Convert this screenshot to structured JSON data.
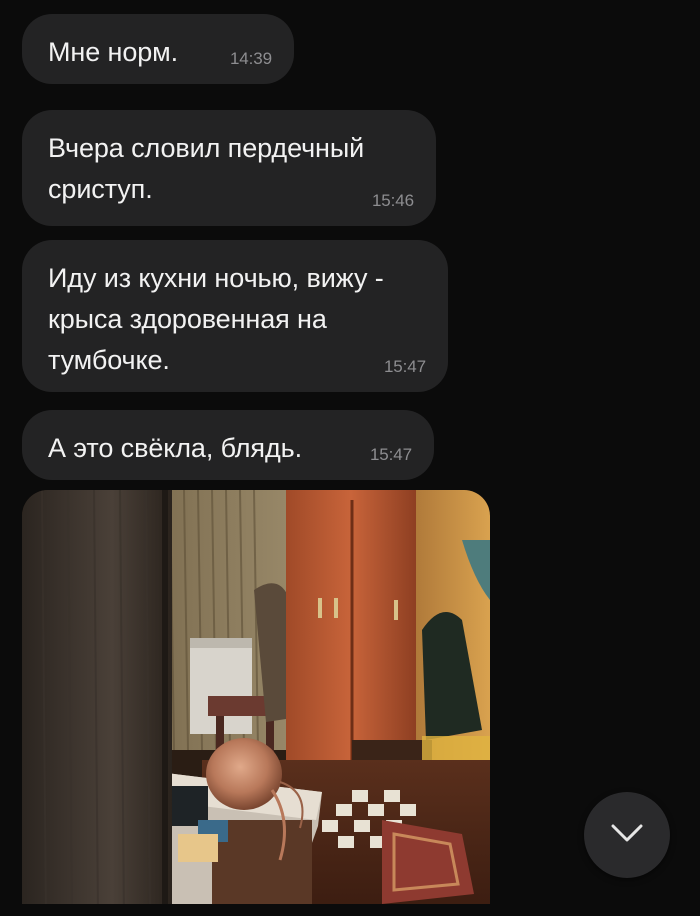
{
  "messages": [
    {
      "text": "Мне норм.",
      "time": "14:39"
    },
    {
      "text": "Вчера словил пердечный сриступ.",
      "time": "15:46"
    },
    {
      "text": "Иду из кухни ночью, вижу - крыса здоровенная на тумбочке.",
      "time": "15:47"
    },
    {
      "text": "А это свёкла, блядь.",
      "time": "15:47"
    }
  ],
  "scroll_button": {
    "icon": "chevron-down-icon"
  },
  "colors": {
    "background": "#0b0b0b",
    "bubble": "#232324",
    "text": "#f2f2f2",
    "time": "#8d8d90"
  }
}
